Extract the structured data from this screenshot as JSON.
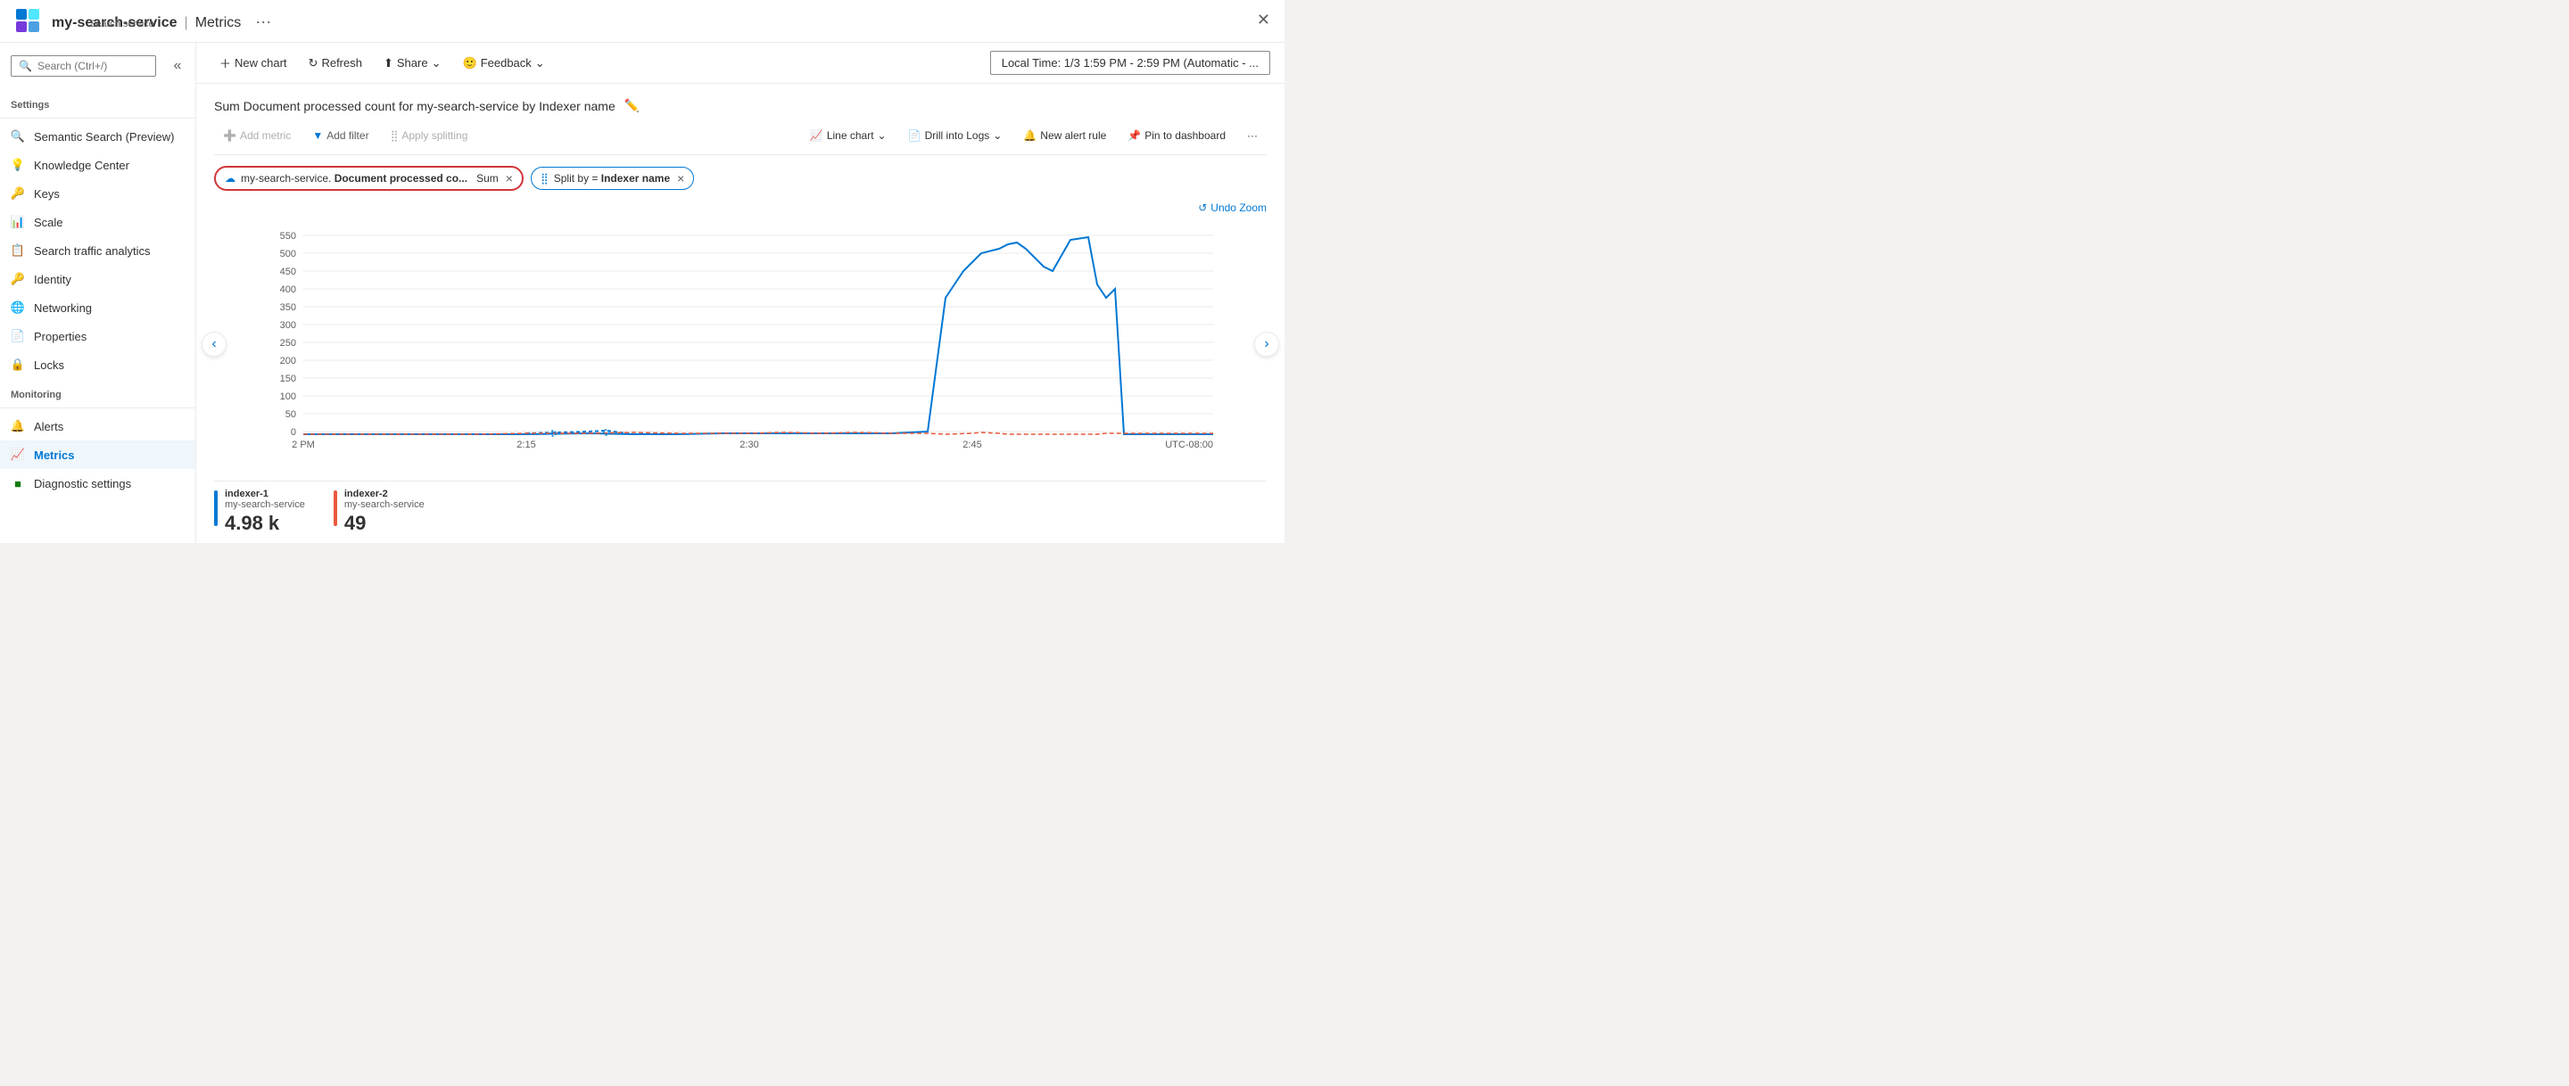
{
  "header": {
    "service_name": "my-search-service",
    "divider": "|",
    "page_title": "Metrics",
    "more_label": "···",
    "subtitle": "Search service",
    "close_label": "✕",
    "search_placeholder": "Search (Ctrl+/)"
  },
  "toolbar": {
    "new_chart": "New chart",
    "refresh": "Refresh",
    "share": "Share",
    "feedback": "Feedback",
    "time_range": "Local Time: 1/3 1:59 PM - 2:59 PM (Automatic - ..."
  },
  "sidebar": {
    "collapse_label": "«",
    "search_placeholder": "Search (Ctrl+/)",
    "sections": [
      {
        "label": "Settings",
        "items": [
          {
            "id": "semantic-search",
            "label": "Semantic Search (Preview)",
            "icon": "🔍"
          },
          {
            "id": "knowledge-center",
            "label": "Knowledge Center",
            "icon": "💡"
          },
          {
            "id": "keys",
            "label": "Keys",
            "icon": "🔑"
          },
          {
            "id": "scale",
            "label": "Scale",
            "icon": "📊"
          },
          {
            "id": "search-traffic",
            "label": "Search traffic analytics",
            "icon": "📋"
          },
          {
            "id": "identity",
            "label": "Identity",
            "icon": "🔑"
          },
          {
            "id": "networking",
            "label": "Networking",
            "icon": "🌐"
          },
          {
            "id": "properties",
            "label": "Properties",
            "icon": "📄"
          },
          {
            "id": "locks",
            "label": "Locks",
            "icon": "🔒"
          }
        ]
      },
      {
        "label": "Monitoring",
        "items": [
          {
            "id": "alerts",
            "label": "Alerts",
            "icon": "🔔"
          },
          {
            "id": "metrics",
            "label": "Metrics",
            "icon": "📈",
            "active": true
          },
          {
            "id": "diagnostic",
            "label": "Diagnostic settings",
            "icon": "🟩"
          }
        ]
      }
    ]
  },
  "chart": {
    "title": "Sum Document processed count for my-search-service by Indexer name",
    "add_metric": "Add metric",
    "add_filter": "Add filter",
    "apply_splitting": "Apply splitting",
    "line_chart": "Line chart",
    "drill_logs": "Drill into Logs",
    "new_alert": "New alert rule",
    "pin_dashboard": "Pin to dashboard",
    "more": "···",
    "undo_zoom": "Undo Zoom",
    "metric_pill": {
      "label": "my-search-service. Document processed co...",
      "agg": "Sum",
      "close": "×"
    },
    "split_pill": {
      "label": "Split by = Indexer name",
      "close": "×"
    },
    "y_labels": [
      "550",
      "500",
      "450",
      "400",
      "350",
      "300",
      "250",
      "200",
      "150",
      "100",
      "50",
      "0"
    ],
    "x_labels": [
      "2 PM",
      "2:15",
      "2:30",
      "2:45",
      "UTC-08:00"
    ],
    "legend": [
      {
        "id": "indexer-1",
        "color": "#0078d4",
        "name": "indexer-1",
        "sub": "my-search-service",
        "value": "4.98 k"
      },
      {
        "id": "indexer-2",
        "color": "#e8583b",
        "name": "indexer-2",
        "sub": "my-search-service",
        "value": "49"
      }
    ]
  }
}
